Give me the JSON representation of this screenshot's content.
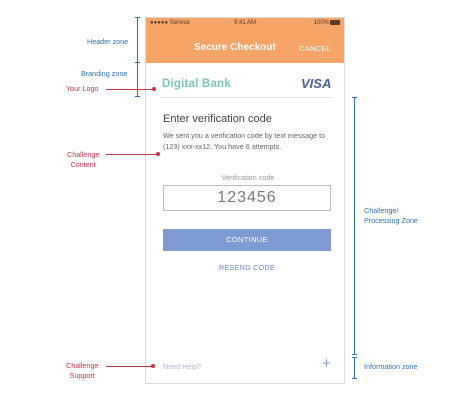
{
  "status_bar": {
    "carrier": "●●●●● Service",
    "time": "9:41 AM",
    "battery": "100%"
  },
  "header": {
    "title": "Secure Checkout",
    "cancel_label": "CANCEL"
  },
  "branding": {
    "bank_name": "Digital Bank",
    "card_brand": "VISA"
  },
  "challenge": {
    "title": "Enter verification code",
    "message": "We sent you a verification code by text message to (123) xxx-xx12. You have 6 attempts.",
    "code_label": "Verification code",
    "code_value": "123456",
    "continue_label": "CONTINUE",
    "resend_label": "RESEND CODE"
  },
  "info": {
    "need_help": "Need Help?"
  },
  "annotations": {
    "header_zone": "Header zone",
    "branding_zone": "Branding zone",
    "your_logo": "Your Logo",
    "challenge_content_1": "Challenge",
    "challenge_content_2": "Content",
    "processing_zone_1": "Challenge/",
    "processing_zone_2": "Processing Zone",
    "information_zone": "Information zone",
    "challenge_support_1": "Challenge",
    "challenge_support_2": "Support"
  },
  "colors": {
    "header": "#f6a467",
    "primary": "#7e9bd4",
    "annotation_blue": "#2f72b6",
    "annotation_red": "#d1304a"
  }
}
